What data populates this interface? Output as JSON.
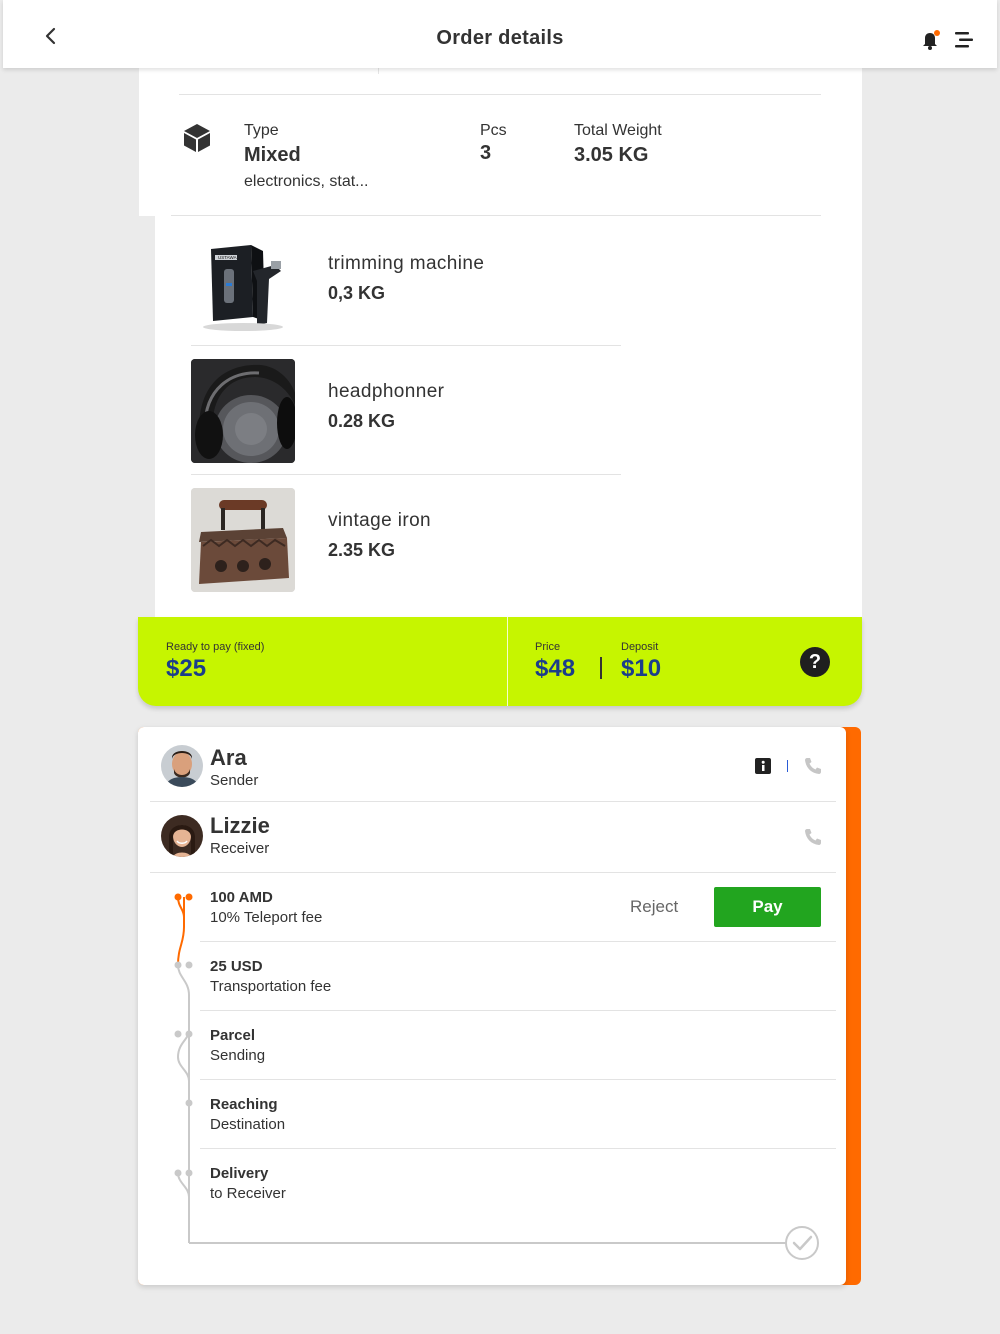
{
  "header": {
    "title": "Order details",
    "back_icon": "chevron-left-icon",
    "notification_icon": "bell-icon",
    "menu_icon": "menu-icon"
  },
  "summary": {
    "type_label": "Type",
    "type_value": "Mixed",
    "type_desc": "electronics, stat...",
    "pcs_label": "Pcs",
    "pcs_value": "3",
    "weight_label": "Total Weight",
    "weight_value": "3.05 KG"
  },
  "items": [
    {
      "name": "trimming machine",
      "weight": "0,3 KG"
    },
    {
      "name": "headphonner",
      "weight": "0.28 KG"
    },
    {
      "name": "vintage iron",
      "weight": "2.35 KG"
    }
  ],
  "payment": {
    "ready_label": "Ready to pay (fixed)",
    "ready_value": "$25",
    "price_label": "Price",
    "price_value": "$48",
    "deposit_label": "Deposit",
    "deposit_value": "$10",
    "help": "?",
    "accent_color": "#c6f500"
  },
  "sender": {
    "name": "Ara",
    "role": "Sender"
  },
  "receiver": {
    "name": "Lizzie",
    "role": "Receiver"
  },
  "steps": [
    {
      "title": "100 AMD",
      "sub": "10% Teleport fee"
    },
    {
      "title": "25 USD",
      "sub": "Transportation fee"
    },
    {
      "title": "Parcel",
      "sub": "Sending"
    },
    {
      "title": "Reaching",
      "sub": "Destination"
    },
    {
      "title": "Delivery",
      "sub": "to Receiver"
    }
  ],
  "actions": {
    "reject": "Reject",
    "pay": "Pay",
    "pay_color": "#22a51f",
    "timeline_color": "#ff6a00"
  },
  "product_thumb_brand": "USTAWA"
}
